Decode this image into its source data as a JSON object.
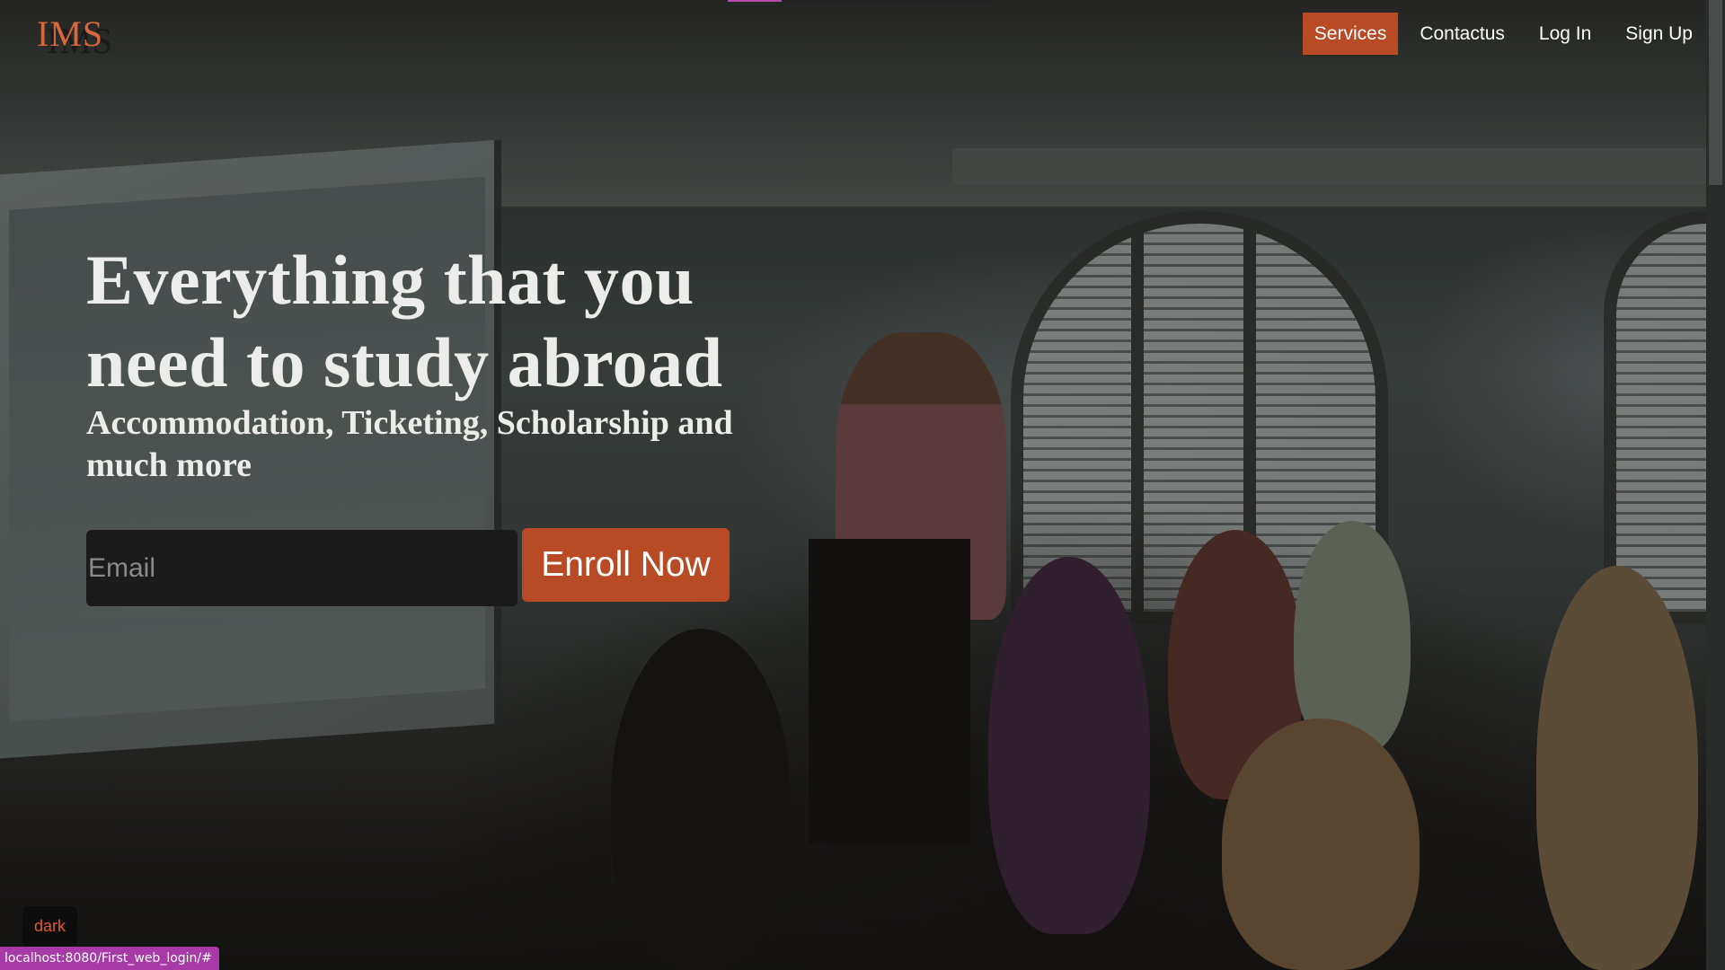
{
  "brand": {
    "logo_text": "IMS",
    "accent_color": "#b84a25",
    "logo_color": "#d8673a"
  },
  "nav": {
    "items": [
      {
        "label": "Services",
        "active": true
      },
      {
        "label": "Contactus",
        "active": false
      },
      {
        "label": "Log In",
        "active": false
      },
      {
        "label": "Sign Up",
        "active": false
      }
    ]
  },
  "hero": {
    "title": "Everything that you need to study abroad",
    "subtitle": "Accommodation, Ticketing, Scholarship and much more",
    "email_placeholder": "Email",
    "email_value": "",
    "enroll_label": "Enroll Now"
  },
  "theme_toggle": {
    "label": "dark"
  },
  "status_bar": {
    "url": "localhost:8080/First_web_login/#"
  }
}
